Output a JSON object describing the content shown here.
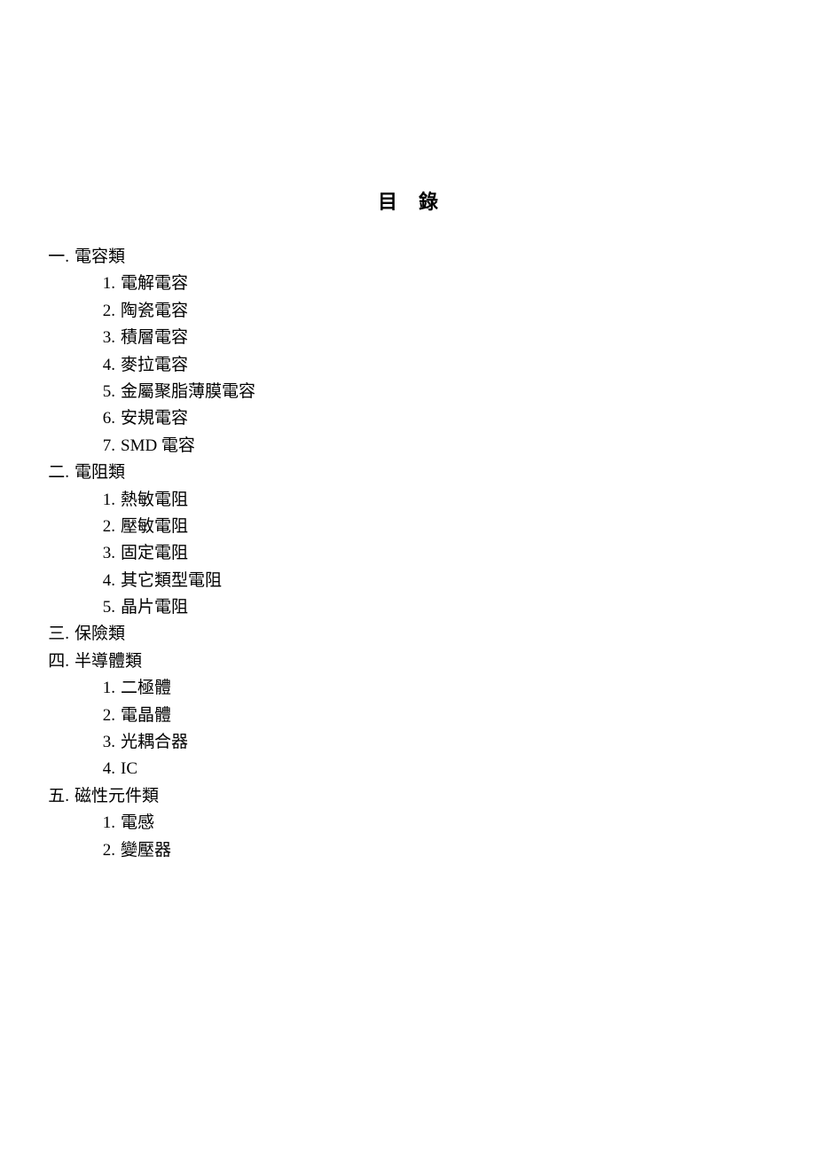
{
  "title": "目錄",
  "sections": [
    {
      "label": "一.",
      "title": "電容類",
      "items": [
        {
          "label": "1.",
          "title": "電解電容"
        },
        {
          "label": "2.",
          "title": "陶瓷電容"
        },
        {
          "label": "3.",
          "title": "積層電容"
        },
        {
          "label": "4.",
          "title": "麥拉電容"
        },
        {
          "label": "5.",
          "title": "金屬聚脂薄膜電容"
        },
        {
          "label": "6.",
          "title": "安規電容"
        },
        {
          "label": "7.",
          "title": "SMD 電容"
        }
      ]
    },
    {
      "label": "二.",
      "title": "電阻類",
      "items": [
        {
          "label": "1.",
          "title": "熱敏電阻"
        },
        {
          "label": "2.",
          "title": "壓敏電阻"
        },
        {
          "label": "3.",
          "title": "固定電阻"
        },
        {
          "label": "4.",
          "title": "其它類型電阻"
        },
        {
          "label": "5.",
          "title": "晶片電阻"
        }
      ]
    },
    {
      "label": "三.",
      "title": "保險類",
      "items": []
    },
    {
      "label": "四.",
      "title": "半導體類",
      "items": [
        {
          "label": "1.",
          "title": "二極體"
        },
        {
          "label": "2.",
          "title": "電晶體"
        },
        {
          "label": "3.",
          "title": "光耦合器"
        },
        {
          "label": "4.",
          "title": "IC"
        }
      ]
    },
    {
      "label": "五.",
      "title": "磁性元件類",
      "items": [
        {
          "label": "1.",
          "title": "電感"
        },
        {
          "label": "2.",
          "title": "變壓器"
        }
      ]
    }
  ]
}
